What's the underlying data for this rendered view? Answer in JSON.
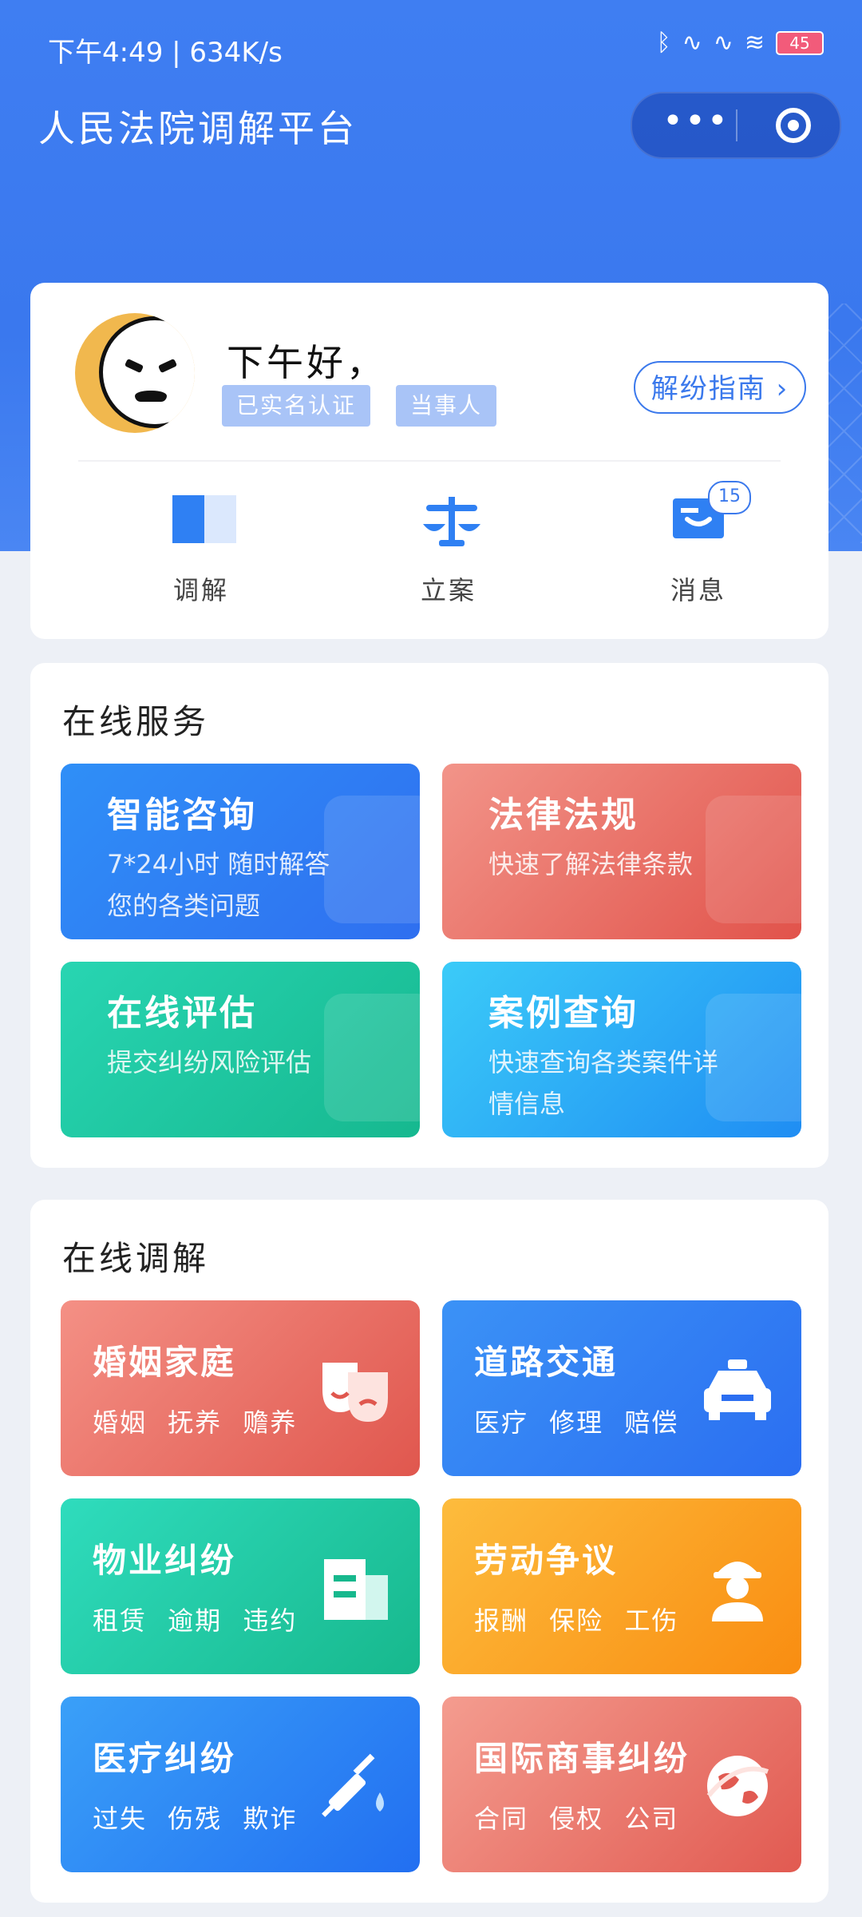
{
  "status_bar": {
    "time_speed": "下午4:49 | 634K/s",
    "battery": "45"
  },
  "app": {
    "title": "人民法院调解平台"
  },
  "profile": {
    "greeting": "下午好，",
    "tags": [
      "已实名认证",
      "当事人"
    ],
    "guide_button": "解纷指南"
  },
  "shortcuts": [
    {
      "label": "调解",
      "icon": "mediation-icon"
    },
    {
      "label": "立案",
      "icon": "scale-icon"
    },
    {
      "label": "消息",
      "icon": "message-icon",
      "badge": "15"
    }
  ],
  "online_services": {
    "title": "在线服务",
    "tiles": [
      {
        "title": "智能咨询",
        "desc": "7*24小时 随时解答您的各类问题",
        "color": "#2f7ff3"
      },
      {
        "title": "法律法规",
        "desc": "快速了解法律条款",
        "color": "#e8665c"
      },
      {
        "title": "在线评估",
        "desc": "提交纠纷风险评估",
        "color": "#1ec7a0"
      },
      {
        "title": "案例查询",
        "desc": "快速查询各类案件详情信息",
        "color": "#2aa7f5"
      }
    ]
  },
  "online_mediation": {
    "title": "在线调解",
    "tiles": [
      {
        "title": "婚姻家庭",
        "tags": "婚姻 抚养 赡养",
        "icon": "masks-icon"
      },
      {
        "title": "道路交通",
        "tags": "医疗 修理 赔偿",
        "icon": "car-icon"
      },
      {
        "title": "物业纠纷",
        "tags": "租赁 逾期 违约",
        "icon": "building-icon"
      },
      {
        "title": "劳动争议",
        "tags": "报酬 保险 工伤",
        "icon": "worker-icon"
      },
      {
        "title": "医疗纠纷",
        "tags": "过失 伤残 欺诈",
        "icon": "syringe-icon"
      },
      {
        "title": "国际商事纠纷",
        "tags": "合同 侵权 公司",
        "icon": "globe-icon"
      }
    ]
  }
}
